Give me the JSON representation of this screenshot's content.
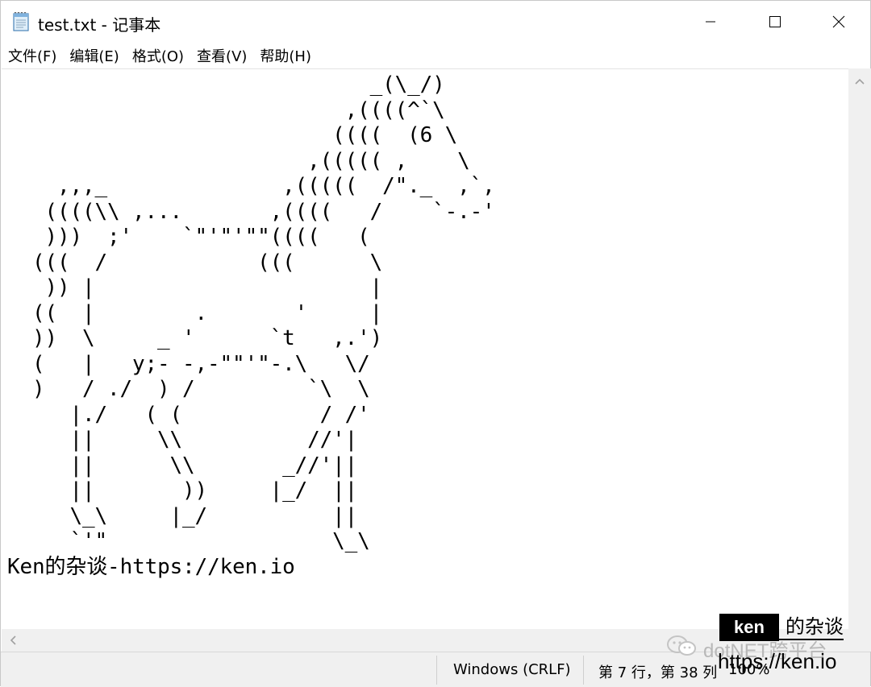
{
  "window": {
    "title": "test.txt - 记事本",
    "icons": {
      "app": "notepad-icon",
      "minimize": "minimize-icon",
      "maximize": "maximize-icon",
      "close": "close-icon"
    }
  },
  "menu": {
    "items": [
      {
        "label": "文件(F)"
      },
      {
        "label": "编辑(E)"
      },
      {
        "label": "格式(O)"
      },
      {
        "label": "查看(V)"
      },
      {
        "label": "帮助(H)"
      }
    ]
  },
  "editor": {
    "content": "                             _(\\_/)\n                           ,((((^`\\\n                          ((((  (6 \\\n                        ,((((( ,    \\\n    ,,,_              ,(((((  /\"._  ,`,\n   ((((\\\\ ,...       ,((((   /    `-.-'\n   )))  ;'    `\"'\"'\"\"((((   (\n  (((  /            (((      \\\n   )) |                      |\n  ((  |        .       '     |\n  ))  \\     _ '      `t   ,.')\n  (   |   y;- -,-\"\"'\"-.\\   \\/\n  )   / ./  ) /         `\\  \\\n     |./   ( (           / /'\n     ||     \\\\          //'|\n     ||      \\\\       _//'||\n     ||       ))     |_/  ||\n     \\_\\     |_/          ||\n     `'\"                  \\_\\\nKen的杂谈-https://ken.io"
  },
  "scrollbars": {
    "up_icon": "scroll-up-arrow-icon",
    "left_icon": "scroll-left-arrow-icon"
  },
  "status": {
    "encoding": "Windows (CRLF)",
    "position": "第 7 行，第 38 列",
    "zoom": "100%"
  },
  "watermark": {
    "brand_box": "ken",
    "brand_text": "的杂谈",
    "wechat_text": "dotNET跨平台",
    "url": "https://ken.io"
  }
}
